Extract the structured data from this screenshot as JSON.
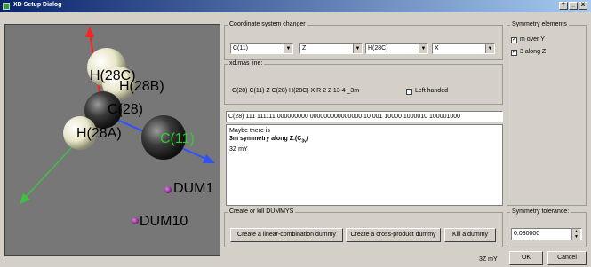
{
  "window": {
    "title": "XD Setup Dialog",
    "help_label": "?",
    "minimize_label": "_",
    "maximize_label": "□",
    "close_label": "X"
  },
  "viewer": {
    "atoms": [
      {
        "label": "H(28C)",
        "color": "#000000"
      },
      {
        "label": "H(28B)",
        "color": "#000000"
      },
      {
        "label": "C(28)",
        "color": "#000000"
      },
      {
        "label": "H(28A)",
        "color": "#000000"
      },
      {
        "label": "C(11)",
        "color": "#33cc33"
      },
      {
        "label": "DUM1",
        "color": "#000000"
      },
      {
        "label": "DUM10",
        "color": "#000000"
      }
    ],
    "axis_colors": {
      "z": "#ff2020",
      "x": "#3050ff",
      "y": "#40c040"
    }
  },
  "coordinate": {
    "title": "Coordinate system changer",
    "combo1": "C(11)",
    "combo2": "Z",
    "combo3": "H(28C)",
    "combo4": "X"
  },
  "xdmas": {
    "title": "xd.mas line:",
    "line": "C(28)   C(11)   Z C(28)   H(28C)   X  R  2  2  13  4  _3m",
    "left_handed_label": "Left handed"
  },
  "binary_field": "C(28)  111 111111 000000000 000000000000000 10 001 10000 1000010 100001000",
  "message": {
    "line1": "Maybe there is",
    "line2_prefix": "3m symmetry along Z.(C",
    "line2_sub": "3v",
    "line2_suffix": ")",
    "line3": "3Z mY"
  },
  "dummys": {
    "title": "Create or kill DUMMYS",
    "linear_label": "Create a linear-combination dummy",
    "cross_label": "Create a cross-product dummy",
    "kill_label": "Kill a dummy"
  },
  "symmetry": {
    "title": "Symmetry elements",
    "items": [
      {
        "label": "m over Y",
        "checked": true
      },
      {
        "label": "3 along Z",
        "checked": true
      }
    ]
  },
  "tolerance": {
    "title": "Symmetry tolerance:",
    "value": "0.030000"
  },
  "footer": {
    "status": "3Z mY",
    "ok_label": "OK",
    "cancel_label": "Cancel"
  }
}
